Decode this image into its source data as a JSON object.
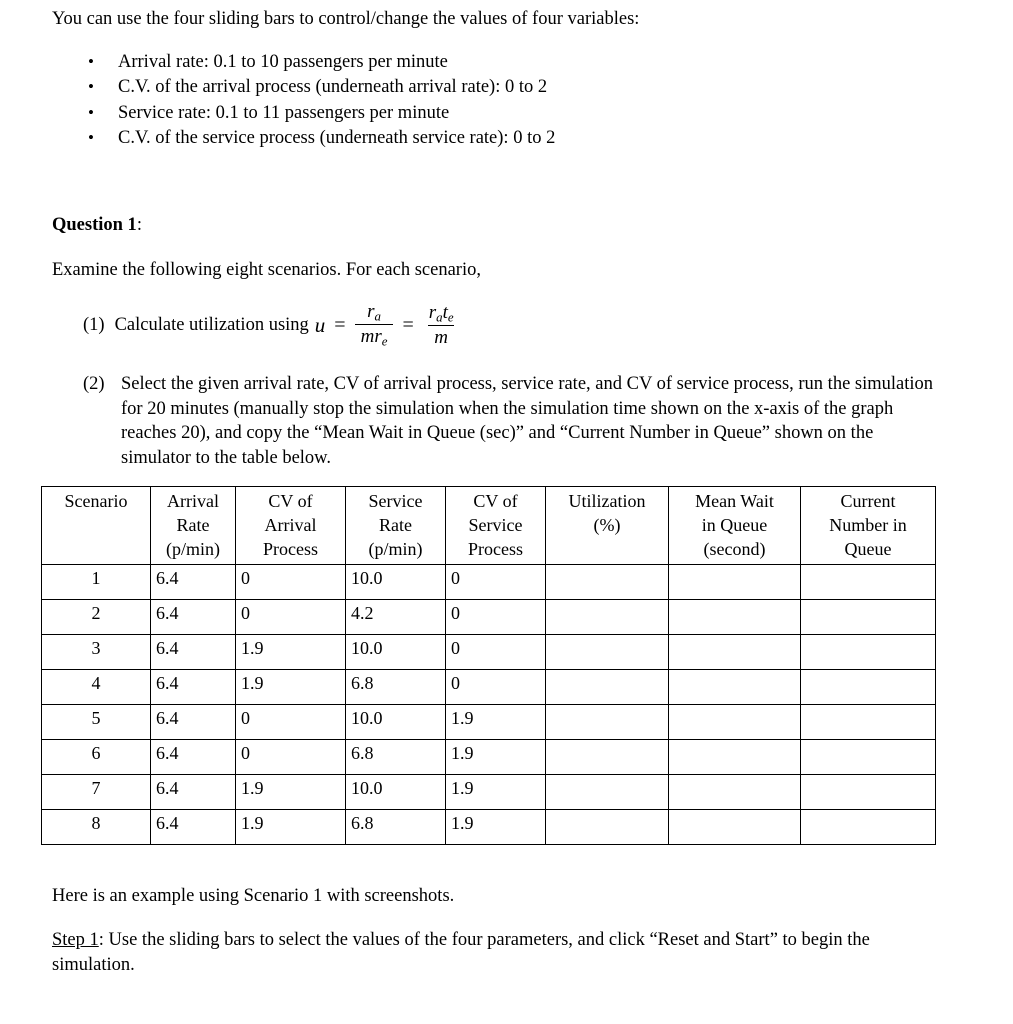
{
  "document": {
    "intro": "You can use the four sliding bars to control/change the values of four variables:",
    "variables": [
      "Arrival rate: 0.1 to 10 passengers per minute",
      "C.V. of the arrival process (underneath arrival rate): 0 to 2",
      "Service rate: 0.1 to 11 passengers per minute",
      "C.V. of the service process (underneath service rate): 0 to 2"
    ],
    "question_heading_bold": "Question 1",
    "question_heading_colon": ":",
    "examine_line": "Examine the following eight scenarios. For each scenario,",
    "item1": {
      "number": "(1)",
      "text": "Calculate utilization using",
      "formula": {
        "lhs": "u",
        "equals1": "=",
        "frac1_numer_var": "r",
        "frac1_numer_sub": "a",
        "frac1_denom_m": "m",
        "frac1_denom_var": "r",
        "frac1_denom_sub": "e",
        "equals2": "=",
        "frac2_numer_var1": "r",
        "frac2_numer_sub1": "a",
        "frac2_numer_var2": "t",
        "frac2_numer_sub2": "e",
        "frac2_denom": "m"
      }
    },
    "item2": {
      "number": "(2)",
      "text": "Select the given arrival rate, CV of arrival process, service rate, and CV of service process, run the simulation for 20 minutes (manually stop the simulation when the simulation time shown on the x-axis of the graph reaches 20), and copy the “Mean Wait in Queue (sec)” and “Current Number in Queue” shown on the simulator to the table below."
    },
    "closing_line": "Here is an example using Scenario 1 with screenshots.",
    "step1": {
      "label": "Step 1",
      "text": ": Use the sliding bars to select the values of the four parameters, and click “Reset and Start” to begin the simulation."
    }
  },
  "table": {
    "headers": [
      {
        "lines": [
          "Scenario"
        ]
      },
      {
        "lines": [
          "Arrival",
          "Rate",
          "(p/min)"
        ]
      },
      {
        "lines": [
          "CV of",
          "Arrival",
          "Process"
        ]
      },
      {
        "lines": [
          "Service",
          "Rate",
          "(p/min)"
        ]
      },
      {
        "lines": [
          "CV of",
          "Service",
          "Process"
        ]
      },
      {
        "lines": [
          "Utilization",
          "(%)"
        ]
      },
      {
        "lines": [
          "Mean Wait",
          "in Queue",
          "(second)"
        ]
      },
      {
        "lines": [
          "Current",
          "Number in",
          "Queue"
        ]
      }
    ],
    "rows": [
      {
        "scenario": "1",
        "arrival_rate": "6.4",
        "cv_arrival": "0",
        "service_rate": "10.0",
        "cv_service": "0",
        "utilization": "",
        "mean_wait": "",
        "current_number": ""
      },
      {
        "scenario": "2",
        "arrival_rate": "6.4",
        "cv_arrival": "0",
        "service_rate": "4.2",
        "cv_service": "0",
        "utilization": "",
        "mean_wait": "",
        "current_number": ""
      },
      {
        "scenario": "3",
        "arrival_rate": "6.4",
        "cv_arrival": "1.9",
        "service_rate": "10.0",
        "cv_service": "0",
        "utilization": "",
        "mean_wait": "",
        "current_number": ""
      },
      {
        "scenario": "4",
        "arrival_rate": "6.4",
        "cv_arrival": "1.9",
        "service_rate": "6.8",
        "cv_service": "0",
        "utilization": "",
        "mean_wait": "",
        "current_number": ""
      },
      {
        "scenario": "5",
        "arrival_rate": "6.4",
        "cv_arrival": "0",
        "service_rate": "10.0",
        "cv_service": "1.9",
        "utilization": "",
        "mean_wait": "",
        "current_number": ""
      },
      {
        "scenario": "6",
        "arrival_rate": "6.4",
        "cv_arrival": "0",
        "service_rate": "6.8",
        "cv_service": "1.9",
        "utilization": "",
        "mean_wait": "",
        "current_number": ""
      },
      {
        "scenario": "7",
        "arrival_rate": "6.4",
        "cv_arrival": "1.9",
        "service_rate": "10.0",
        "cv_service": "1.9",
        "utilization": "",
        "mean_wait": "",
        "current_number": ""
      },
      {
        "scenario": "8",
        "arrival_rate": "6.4",
        "cv_arrival": "1.9",
        "service_rate": "6.8",
        "cv_service": "1.9",
        "utilization": "",
        "mean_wait": "",
        "current_number": ""
      }
    ]
  }
}
